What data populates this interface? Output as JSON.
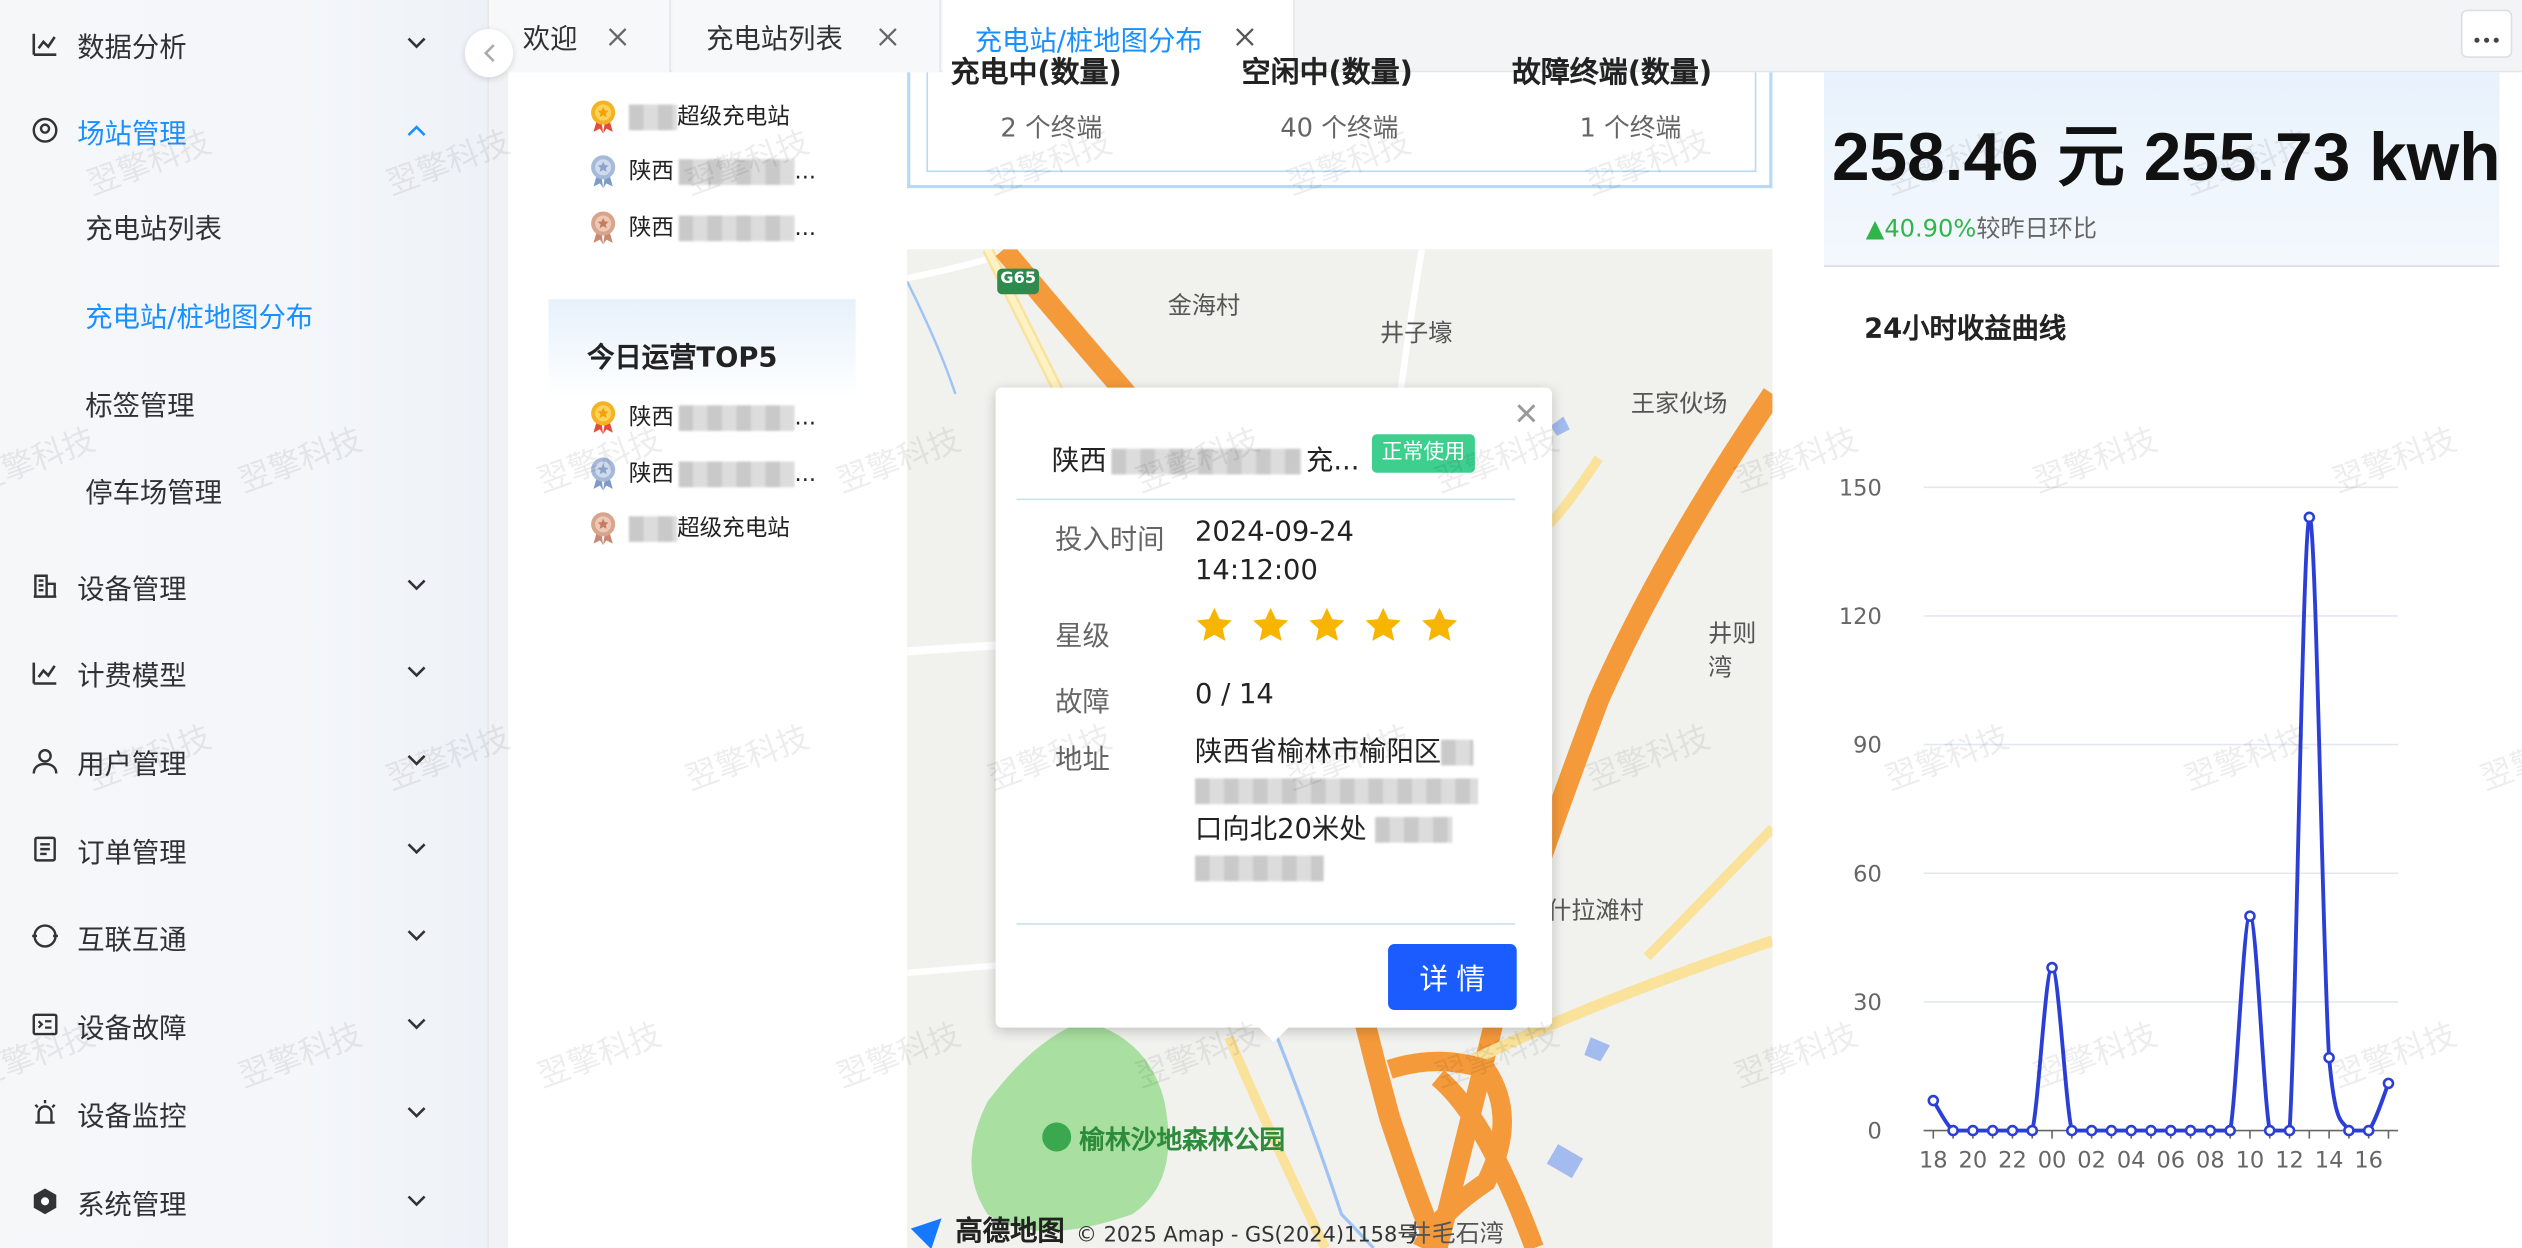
{
  "sidebar": {
    "items": [
      {
        "label": "数据分析",
        "icon": "chart-icon"
      },
      {
        "label": "场站管理",
        "icon": "location-icon",
        "expanded": true,
        "children": [
          "充电站列表",
          "充电站/桩地图分布",
          "标签管理",
          "停车场管理"
        ],
        "active_child": 1
      },
      {
        "label": "设备管理",
        "icon": "building-icon"
      },
      {
        "label": "计费模型",
        "icon": "chart-icon"
      },
      {
        "label": "用户管理",
        "icon": "user-icon"
      },
      {
        "label": "订单管理",
        "icon": "document-icon"
      },
      {
        "label": "互联互通",
        "icon": "circle-icon"
      },
      {
        "label": "设备故障",
        "icon": "fault-icon"
      },
      {
        "label": "设备监控",
        "icon": "monitor-icon"
      },
      {
        "label": "系统管理",
        "icon": "shield-icon"
      }
    ]
  },
  "tabs": [
    {
      "label": "欢迎"
    },
    {
      "label": "充电站列表"
    },
    {
      "label": "充电站/桩地图分布",
      "active": true
    }
  ],
  "ranking": {
    "top_list": [
      {
        "medal": "gold",
        "suffix": "超级充电站"
      },
      {
        "medal": "silver",
        "prefix": "陕西",
        "suffix": "..."
      },
      {
        "medal": "bronze",
        "prefix": "陕西",
        "suffix": "..."
      }
    ],
    "today_title": "今日运营TOP5",
    "today_list": [
      {
        "medal": "gold",
        "prefix": "陕西",
        "suffix": "..."
      },
      {
        "medal": "silver",
        "prefix": "陕西",
        "suffix": "..."
      },
      {
        "medal": "bronze",
        "suffix": "超级充电站"
      }
    ]
  },
  "terminals": [
    {
      "title": "充电中(数量)",
      "value": "2 个终端"
    },
    {
      "title": "空闲中(数量)",
      "value": "40 个终端"
    },
    {
      "title": "故障终端(数量)",
      "value": "1 个终端"
    }
  ],
  "map": {
    "labels": [
      "金海村",
      "井子壕",
      "王家伙场",
      "井则湾",
      "什拉滩村",
      "榆林沙地森林公园",
      "井毛石湾"
    ],
    "highway": "G65",
    "brand": "高德地图",
    "copyright": "© 2025 Amap - GS(2024)1158号"
  },
  "popup": {
    "title_prefix": "陕西",
    "title_suffix": "充...",
    "status": "正常使用",
    "rows": [
      {
        "label": "投入时间",
        "value_line1": "2024-09-24",
        "value_line2": "14:12:00"
      },
      {
        "label": "星级",
        "stars": 5
      },
      {
        "label": "故障",
        "value": "0 / 14"
      },
      {
        "label": "地址",
        "value_line1": "陕西省榆林市榆阳区",
        "value_line2": "口向北20米处"
      }
    ],
    "detail_button": "详 情"
  },
  "kpi": {
    "revenue": "258.46 元",
    "energy": "255.73 kwh",
    "change": "40.90%",
    "change_label": "较昨日环比"
  },
  "chart_data": {
    "type": "line",
    "title": "24小时收益曲线",
    "x": [
      "18",
      "19",
      "20",
      "21",
      "22",
      "23",
      "00",
      "01",
      "02",
      "03",
      "04",
      "05",
      "06",
      "07",
      "08",
      "09",
      "10",
      "11",
      "12",
      "13",
      "14",
      "15",
      "16",
      "17"
    ],
    "tick_labels": [
      "18",
      "20",
      "22",
      "00",
      "02",
      "04",
      "06",
      "08",
      "10",
      "12",
      "14",
      "16"
    ],
    "values": [
      7,
      0,
      0,
      0,
      0,
      0,
      38,
      0,
      0,
      0,
      0,
      0,
      0,
      0,
      0,
      0,
      50,
      0,
      0,
      143,
      17,
      0,
      0,
      11
    ],
    "ylim": [
      0,
      150
    ],
    "yticks": [
      0,
      30,
      60,
      90,
      120,
      150
    ],
    "grid": true,
    "color": "#2b3fd6"
  },
  "watermark": "翌擎科技"
}
